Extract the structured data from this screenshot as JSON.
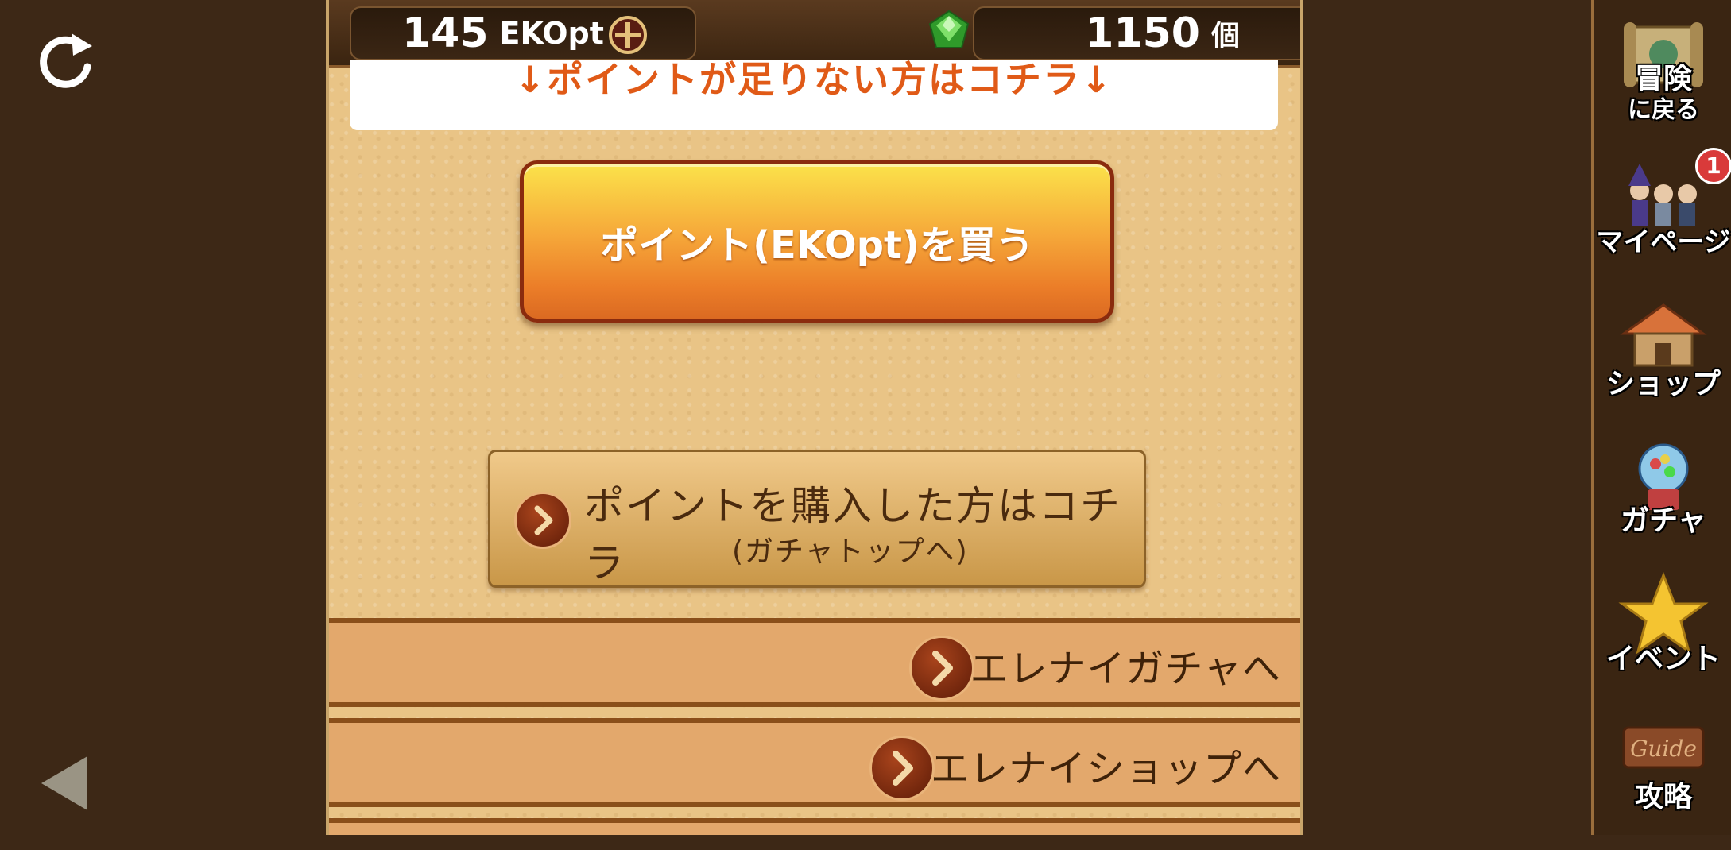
{
  "header": {
    "points_value": "145",
    "points_unit": "EKOpt",
    "gems_value": "1150",
    "gems_unit": "個"
  },
  "notice": {
    "text": "↓ポイントが足りない方はコチラ↓"
  },
  "buy_button": {
    "label": "ポイント(EKOpt)を買う"
  },
  "purchased_button": {
    "line1": "ポイントを購入した方はコチラ",
    "line2": "(ガチャトップへ)"
  },
  "nav_rows": [
    {
      "label": "エレナイガチャへ"
    },
    {
      "label": "エレナイショップへ"
    }
  ],
  "sidebar": {
    "items": [
      {
        "label_line1": "冒険",
        "label_line2": "に戻る",
        "icon": "scroll-map-icon"
      },
      {
        "label": "マイページ",
        "icon": "party-characters-icon",
        "badge": "1"
      },
      {
        "label": "ショップ",
        "icon": "shop-house-icon"
      },
      {
        "label": "ガチャ",
        "icon": "gacha-machine-icon"
      },
      {
        "label": "イベント",
        "icon": "star-icon"
      },
      {
        "label": "攻略",
        "icon": "guide-sign-icon",
        "sign_text": "Guide"
      }
    ]
  },
  "colors": {
    "notice_text": "#e05a17",
    "buy_button_top": "#fbe24a",
    "buy_button_bottom": "#db6a22",
    "badge": "#d93a3a"
  }
}
